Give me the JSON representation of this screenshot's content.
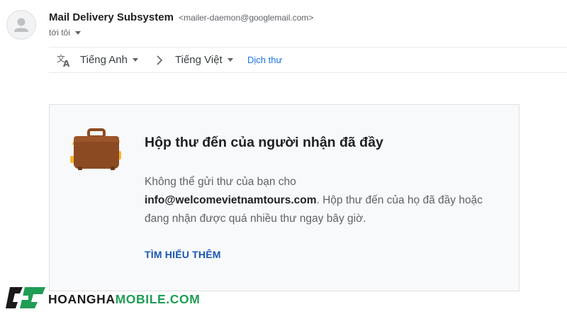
{
  "header": {
    "sender_name": "Mail Delivery Subsystem",
    "sender_email": "<mailer-daemon@googlemail.com>",
    "recipient_label": "tới tôi"
  },
  "translate_bar": {
    "source_language": "Tiếng Anh",
    "target_language": "Tiếng Việt",
    "translate_link": "Dịch thư"
  },
  "bounce_card": {
    "title": "Hộp thư đến của người nhận đã đầy",
    "body_prefix": "Không thể gửi thư của bạn cho",
    "email": "info@welcomevietnamtours.com",
    "body_suffix": ". Hộp thư đến của họ đã đầy hoặc đang nhận được quá nhiều thư ngay bây giờ.",
    "learn_more": "TÌM HIỂU THÊM"
  },
  "watermark": {
    "part1": "HOANGHA",
    "part2": "MOBILE.COM"
  },
  "colors": {
    "link_blue": "#1a73e8",
    "learn_more_blue": "#1a56b0",
    "briefcase_brown": "#8b4a22",
    "briefcase_yellow": "#f5b82e",
    "brand_green": "#1f9d55"
  }
}
